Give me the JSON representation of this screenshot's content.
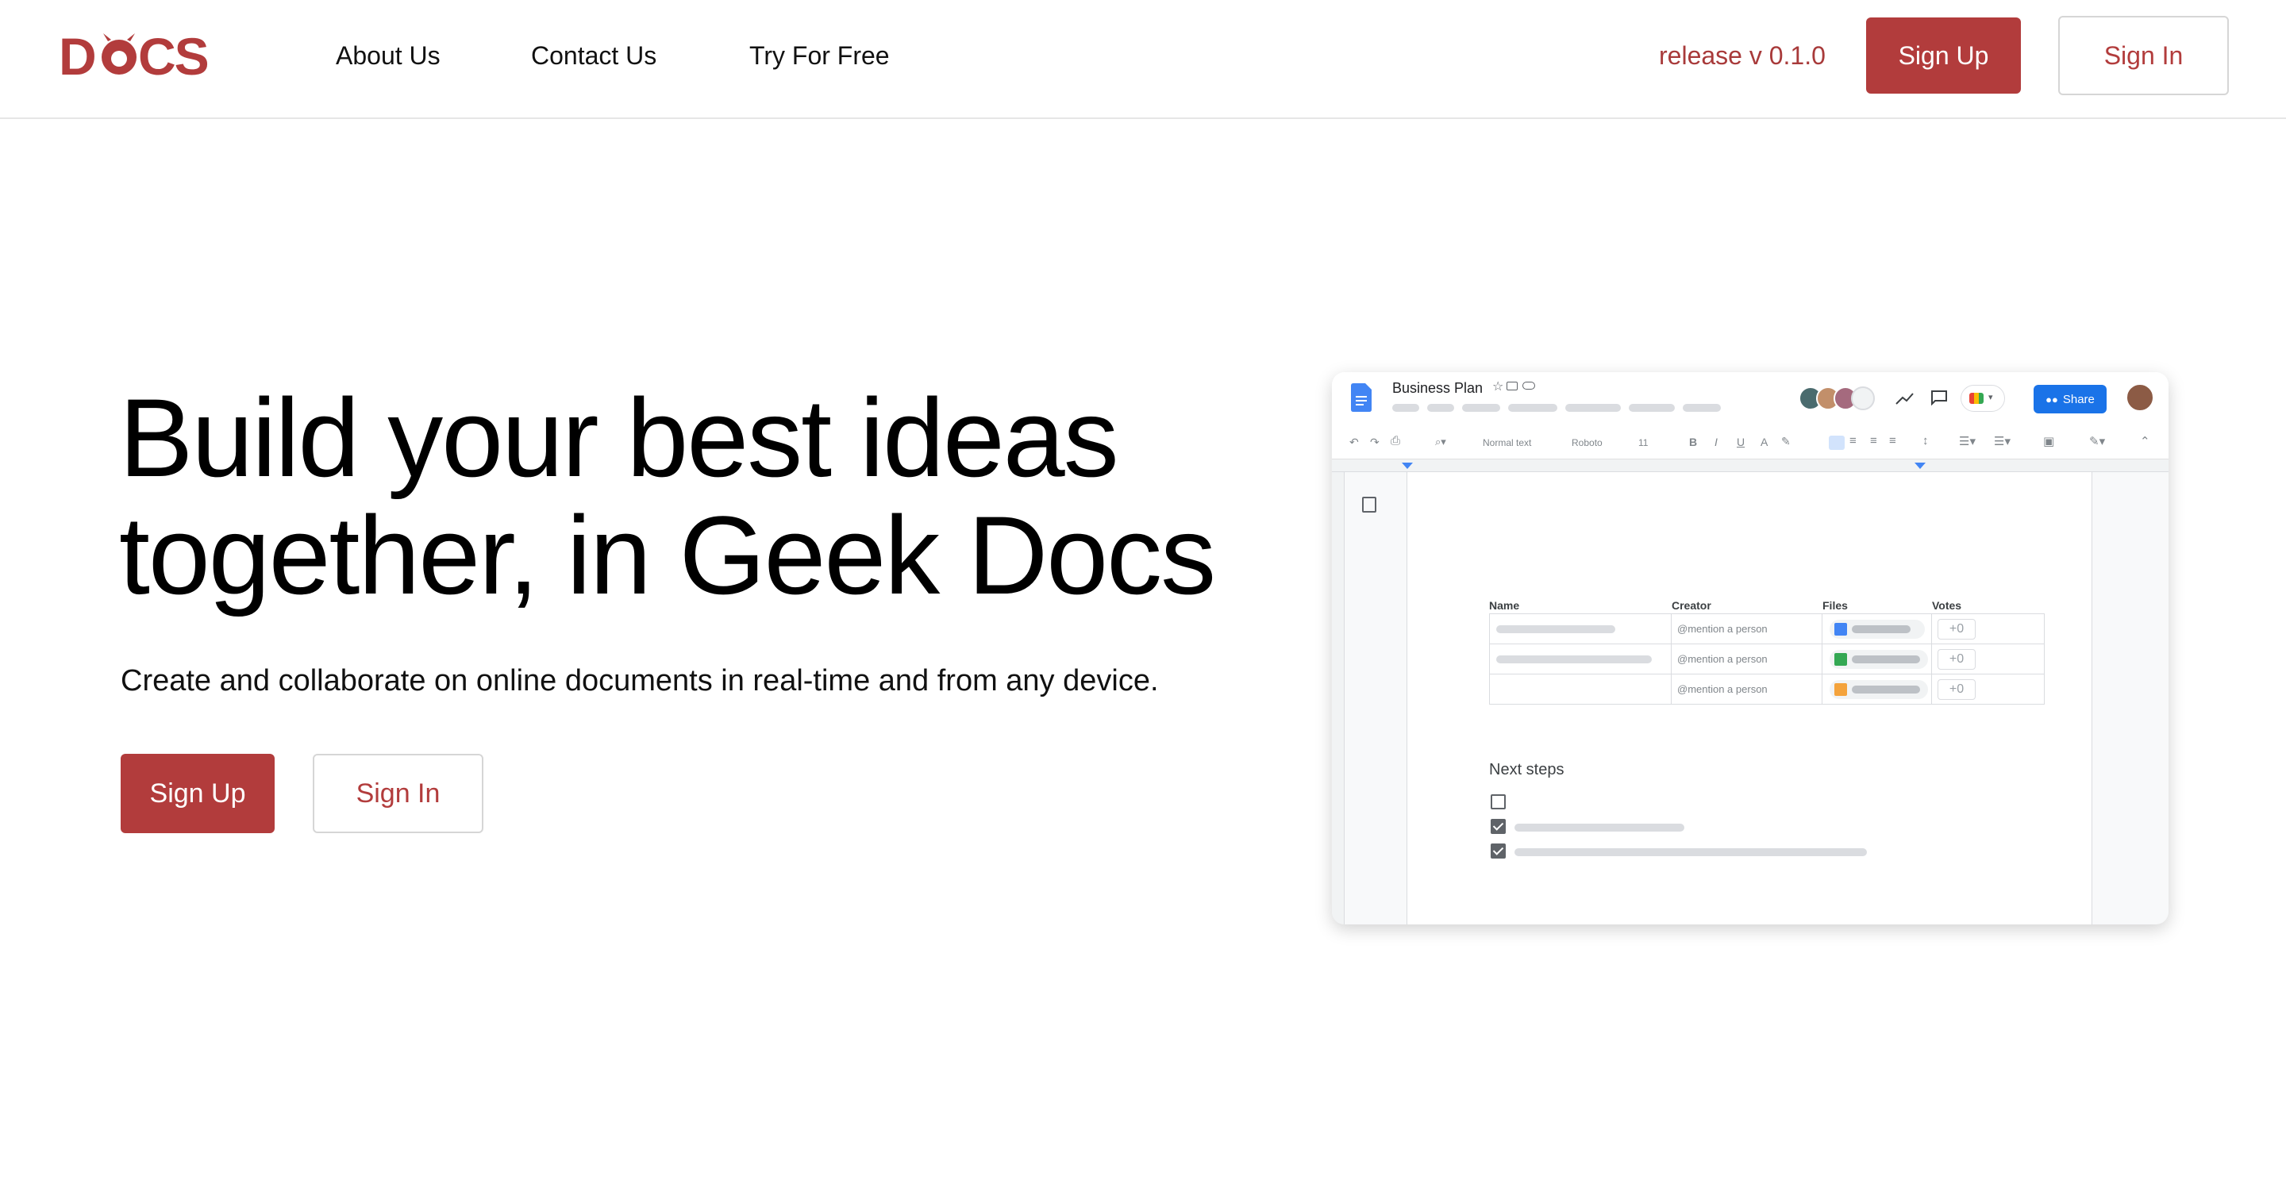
{
  "brand": {
    "logo_text": "DOCS",
    "accent_color": "#b23c3c"
  },
  "nav": {
    "links": [
      "About Us",
      "Contact Us",
      "Try For Free"
    ],
    "release": "release v 0.1.0",
    "sign_up": "Sign Up",
    "sign_in": "Sign In"
  },
  "hero": {
    "title_line1": "Build your best ideas",
    "title_line2": "together, in Geek Docs",
    "subtitle": "Create and collaborate on online documents in real-time and from any device.",
    "sign_up": "Sign Up",
    "sign_in": "Sign In"
  },
  "mockup": {
    "doc_title": "Business Plan",
    "share_label": "Share",
    "toolbar": {
      "style": "Normal text",
      "font": "Roboto",
      "size": "11"
    },
    "table": {
      "headers": [
        "Name",
        "Creator",
        "Files",
        "Votes"
      ],
      "rows": [
        {
          "creator": "@mention a person",
          "vote": "+0",
          "file_color": "#4285f4"
        },
        {
          "creator": "@mention a person",
          "vote": "+0",
          "file_color": "#34a853"
        },
        {
          "creator": "@mention a person",
          "vote": "+0",
          "file_color": "#f4a33c"
        }
      ]
    },
    "next_steps": "Next steps",
    "checklist": [
      false,
      true,
      true
    ]
  }
}
